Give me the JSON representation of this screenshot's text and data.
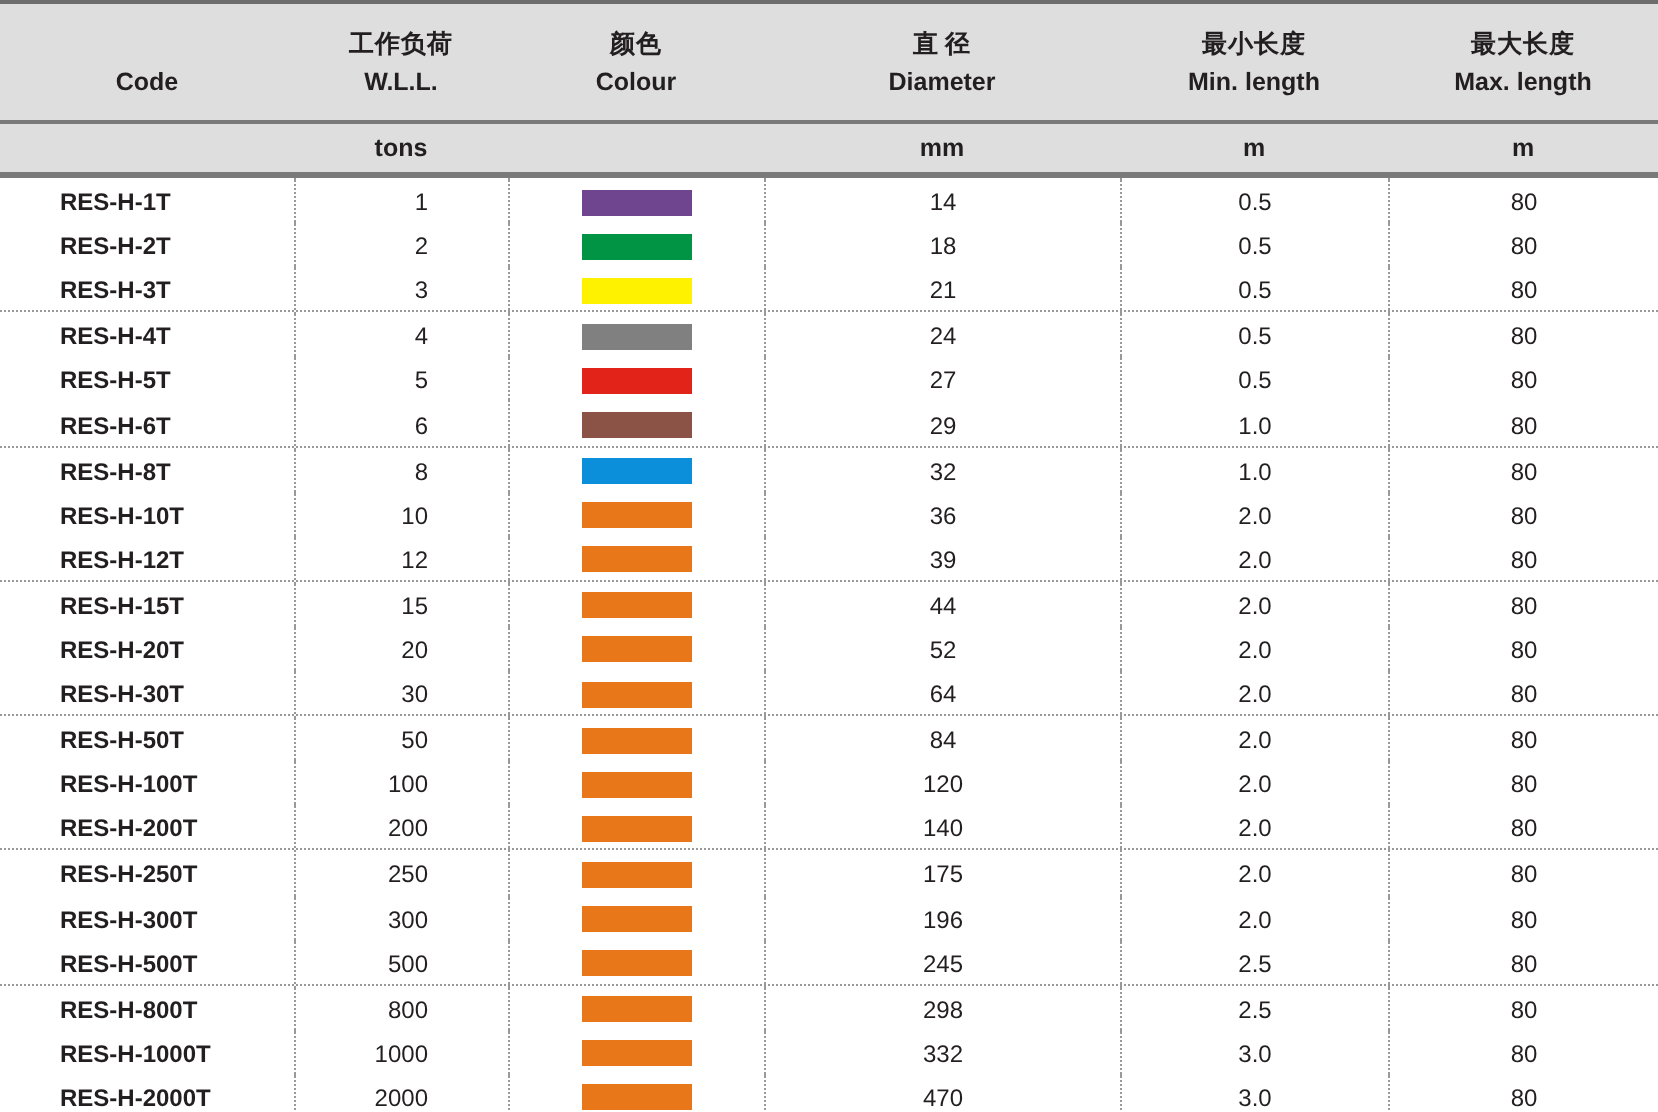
{
  "columns": [
    {
      "label": "Code"
    },
    {
      "label_zh": "工作负荷",
      "label": "W.L.L.",
      "unit": "tons"
    },
    {
      "label_zh": "颜色",
      "label": "Colour"
    },
    {
      "label_zh": "直 径",
      "label": "Diameter",
      "unit": "mm"
    },
    {
      "label_zh": "最小长度",
      "label": "Min. length",
      "unit": "m"
    },
    {
      "label_zh": "最大长度",
      "label": "Max. length",
      "unit": "m"
    }
  ],
  "groups": [
    {
      "rows": [
        {
          "code": "RES-H-1T",
          "wll": "1",
          "color": "#6f4590",
          "diameter": "14",
          "min_length": "0.5",
          "max_length": "80"
        },
        {
          "code": "RES-H-2T",
          "wll": "2",
          "color": "#009444",
          "diameter": "18",
          "min_length": "0.5",
          "max_length": "80"
        },
        {
          "code": "RES-H-3T",
          "wll": "3",
          "color": "#fff200",
          "diameter": "21",
          "min_length": "0.5",
          "max_length": "80"
        }
      ]
    },
    {
      "rows": [
        {
          "code": "RES-H-4T",
          "wll": "4",
          "color": "#808080",
          "diameter": "24",
          "min_length": "0.5",
          "max_length": "80"
        },
        {
          "code": "RES-H-5T",
          "wll": "5",
          "color": "#e2231a",
          "diameter": "27",
          "min_length": "0.5",
          "max_length": "80"
        },
        {
          "code": "RES-H-6T",
          "wll": "6",
          "color": "#8b5346",
          "diameter": "29",
          "min_length": "1.0",
          "max_length": "80"
        }
      ]
    },
    {
      "rows": [
        {
          "code": "RES-H-8T",
          "wll": "8",
          "color": "#0b8fdb",
          "diameter": "32",
          "min_length": "1.0",
          "max_length": "80"
        },
        {
          "code": "RES-H-10T",
          "wll": "10",
          "color": "#e8771a",
          "diameter": "36",
          "min_length": "2.0",
          "max_length": "80"
        },
        {
          "code": "RES-H-12T",
          "wll": "12",
          "color": "#e8771a",
          "diameter": "39",
          "min_length": "2.0",
          "max_length": "80"
        }
      ]
    },
    {
      "rows": [
        {
          "code": "RES-H-15T",
          "wll": "15",
          "color": "#e8771a",
          "diameter": "44",
          "min_length": "2.0",
          "max_length": "80"
        },
        {
          "code": "RES-H-20T",
          "wll": "20",
          "color": "#e8771a",
          "diameter": "52",
          "min_length": "2.0",
          "max_length": "80"
        },
        {
          "code": "RES-H-30T",
          "wll": "30",
          "color": "#e8771a",
          "diameter": "64",
          "min_length": "2.0",
          "max_length": "80"
        }
      ]
    },
    {
      "rows": [
        {
          "code": "RES-H-50T",
          "wll": "50",
          "color": "#e8771a",
          "diameter": "84",
          "min_length": "2.0",
          "max_length": "80"
        },
        {
          "code": "RES-H-100T",
          "wll": "100",
          "color": "#e8771a",
          "diameter": "120",
          "min_length": "2.0",
          "max_length": "80"
        },
        {
          "code": "RES-H-200T",
          "wll": "200",
          "color": "#e8771a",
          "diameter": "140",
          "min_length": "2.0",
          "max_length": "80"
        }
      ]
    },
    {
      "rows": [
        {
          "code": "RES-H-250T",
          "wll": "250",
          "color": "#e8771a",
          "diameter": "175",
          "min_length": "2.0",
          "max_length": "80"
        },
        {
          "code": "RES-H-300T",
          "wll": "300",
          "color": "#e8771a",
          "diameter": "196",
          "min_length": "2.0",
          "max_length": "80"
        },
        {
          "code": "RES-H-500T",
          "wll": "500",
          "color": "#e8771a",
          "diameter": "245",
          "min_length": "2.5",
          "max_length": "80"
        }
      ]
    },
    {
      "rows": [
        {
          "code": "RES-H-800T",
          "wll": "800",
          "color": "#e8771a",
          "diameter": "298",
          "min_length": "2.5",
          "max_length": "80"
        },
        {
          "code": "RES-H-1000T",
          "wll": "1000",
          "color": "#e8771a",
          "diameter": "332",
          "min_length": "3.0",
          "max_length": "80"
        },
        {
          "code": "RES-H-2000T",
          "wll": "2000",
          "color": "#e8771a",
          "diameter": "470",
          "min_length": "3.0",
          "max_length": "80"
        }
      ]
    }
  ]
}
